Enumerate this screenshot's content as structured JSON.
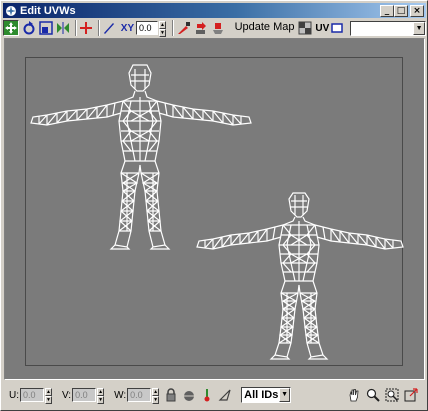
{
  "window": {
    "title": "Edit UVWs",
    "controls": [
      "minimize",
      "maximize",
      "close"
    ]
  },
  "toolbar": {
    "tools": [
      {
        "name": "move-icon",
        "pressed": true
      },
      {
        "name": "rotate-icon"
      },
      {
        "name": "scale-icon"
      },
      {
        "name": "mirror-icon"
      },
      {
        "name": "freeform-icon"
      },
      {
        "name": "pen-icon"
      }
    ],
    "axis_label": "XY",
    "value": "0.0",
    "update_map_label": "Update Map",
    "uv_label": "UV",
    "texture_dropdown_value": ""
  },
  "viewport": {
    "background_color": "#7b7b7b",
    "mesh_color": "#ffffff",
    "meshes": [
      "front-figure",
      "back-figure"
    ]
  },
  "bottom": {
    "u_label": "U:",
    "v_label": "V:",
    "w_label": "W:",
    "u_value": "0.0",
    "v_value": "0.0",
    "w_value": "0.0",
    "ids_value": "All IDs"
  }
}
